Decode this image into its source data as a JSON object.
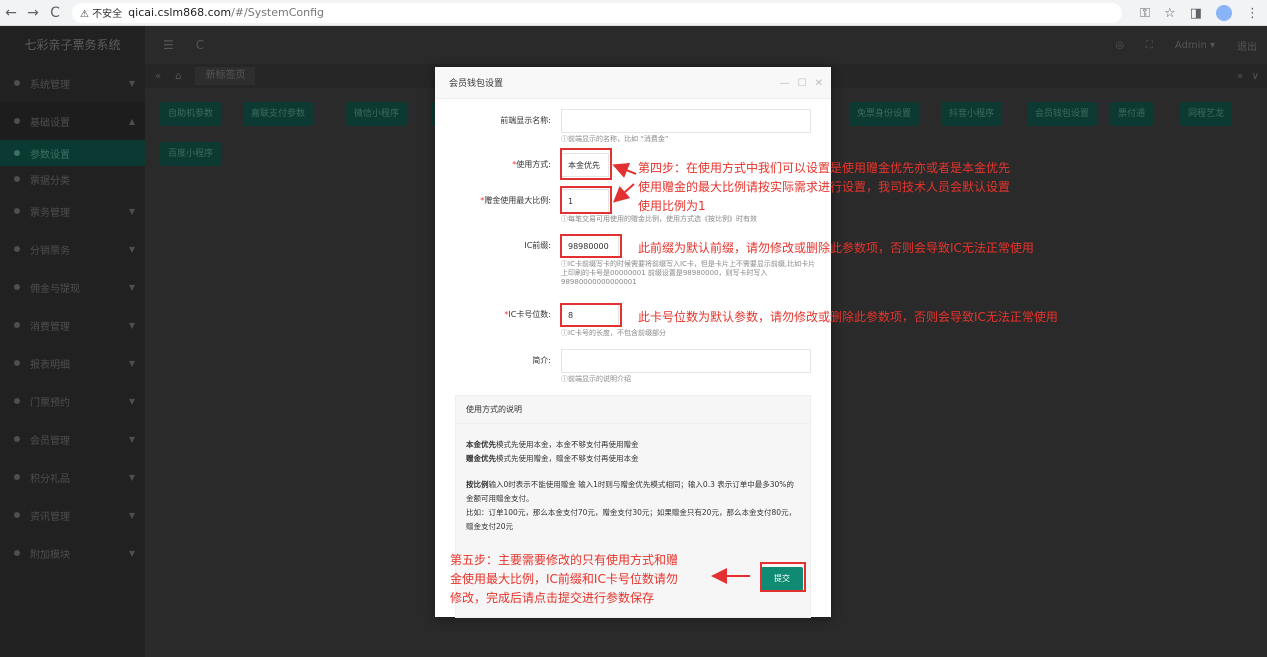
{
  "browser": {
    "back": "←",
    "forward": "→",
    "reload": "C",
    "insecure": "⚠ 不安全",
    "url_host": "qicai.cslm868.com",
    "url_path": "/#/SystemConfig"
  },
  "sidebar": {
    "brand": "七彩亲子票务系统",
    "items": [
      {
        "label": "系统管理"
      },
      {
        "label": "基础设置"
      },
      {
        "label": "参数设置"
      },
      {
        "label": "票据分类"
      },
      {
        "label": "票务管理"
      },
      {
        "label": "分销票务"
      },
      {
        "label": "佣金与提现"
      },
      {
        "label": "消费管理"
      },
      {
        "label": "报表明细"
      },
      {
        "label": "门票预约"
      },
      {
        "label": "会员管理"
      },
      {
        "label": "积分礼品"
      },
      {
        "label": "资讯管理"
      },
      {
        "label": "附加模块"
      }
    ]
  },
  "topbar": {
    "menu_icon": "☰",
    "refresh_icon": "C",
    "user": "Admin ▾",
    "logout": "退出"
  },
  "tabs": {
    "home": "⌂",
    "current": "新标签页"
  },
  "config_buttons": [
    "自助机参数",
    "嘉联支付参数",
    "微信小程序",
    "免票身份设置",
    "抖音小程序",
    "会员钱包设置",
    "票付通",
    "同程艺龙",
    "百度小程序"
  ],
  "modal": {
    "title": "会员钱包设置",
    "ctrl_min": "—",
    "ctrl_max": "☐",
    "ctrl_close": "✕",
    "fields": {
      "display_name": {
        "label": "前端显示名称:",
        "value": "",
        "hint": "ⓘ前端显示的名称，比如 “消费金”"
      },
      "use_mode": {
        "req": "*",
        "label": "使用方式:",
        "value": "本金优先"
      },
      "max_ratio": {
        "req": "*",
        "label": "赠金使用最大比例:",
        "value": "1",
        "hint": "ⓘ每笔交易可用使用的赠金比例，使用方式选《按比例》时有效"
      },
      "ic_prefix": {
        "label": "IC前缀:",
        "value": "98980000",
        "hint": "ⓘIC卡前缀写卡的时候需要将前缀写入IC卡，但是卡片上不需要显示前缀,比如卡片上印刷的卡号是00000001 前缀设置是98980000，则写卡时写入98980000000000001"
      },
      "ic_digits": {
        "req": "*",
        "label": "IC卡号位数:",
        "value": "8",
        "hint": "ⓘIC卡号的长度，不包含前缀部分"
      },
      "intro": {
        "label": "简介:",
        "value": "",
        "hint": "ⓘ前端显示的说明介绍"
      }
    },
    "info": {
      "title": "使用方式的说明",
      "line1_bold": "本金优先",
      "line1_rest": "模式先使用本金，本金不够支付再使用赠金",
      "line2_bold": "赠金优先",
      "line2_rest": "模式先使用赠金，赠金不够支付再使用本金",
      "line3_bold": "按比例",
      "line3_rest": "输入0时表示不能使用赠金 输入1时则与赠金优先模式相同；输入0.3 表示订单中最多30%的金额可用赠金支付。",
      "line4": "比如：订单100元，那么本金支付70元，赠金支付30元；如果赠金只有20元，那么本金支付80元，赠金支付20元"
    },
    "submit": "提交"
  },
  "annotations": {
    "step4_l1": "第四步：在使用方式中我们可以设置是使用赠金优先亦或者是本金优先",
    "step4_l2": "使用赠金的最大比例请按实际需求进行设置，我司技术人员会默认设置",
    "step4_l3": "使用比例为1",
    "prefix_note": "此前缀为默认前缀，请勿修改或删除此参数项，否则会导致IC无法正常使用",
    "digits_note": "此卡号位数为默认参数，请勿修改或删除此参数项，否则会导致IC无法正常使用",
    "step5_l1": "第五步：主要需要修改的只有使用方式和赠",
    "step5_l2": "金使用最大比例，IC前缀和IC卡号位数请勿",
    "step5_l3": "修改，完成后请点击提交进行参数保存"
  }
}
